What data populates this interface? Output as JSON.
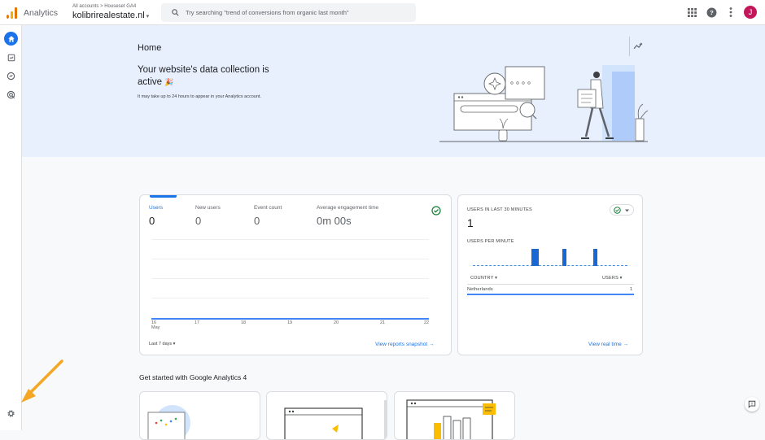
{
  "header": {
    "app_name": "Analytics",
    "breadcrumb": "All accounts > Houseset GA4",
    "property": "kolibrirealestate.nl",
    "property_caret": "▾",
    "search_placeholder": "Try searching \"trend of conversions from organic last month\"",
    "avatar_letter": "J",
    "logo_colors": [
      "#f9ab00",
      "#e37400",
      "#e37400"
    ]
  },
  "nav": {
    "items": [
      "home-icon",
      "reports-icon",
      "explore-icon",
      "advertising-icon"
    ],
    "active_color": "#1a73e8",
    "settings": "gear-icon"
  },
  "hero": {
    "title": "Home",
    "headline_line1": "Your website's data collection is",
    "headline_line2": "active",
    "headline_emoji": "🎉",
    "subtext": "It may take up to 24 hours to appear in your Analytics account."
  },
  "overview": {
    "metrics": [
      {
        "label": "Users",
        "value": "0"
      },
      {
        "label": "New users",
        "value": "0"
      },
      {
        "label": "Event count",
        "value": "0"
      },
      {
        "label": "Average engagement time",
        "value": "0m 00s"
      }
    ],
    "x_ticks": [
      "16",
      "17",
      "18",
      "19",
      "20",
      "21",
      "22"
    ],
    "x_month": "May",
    "date_range": "Last 7 days ▾",
    "link": "View reports snapshot →"
  },
  "realtime": {
    "title": "USERS IN LAST 30 MINUTES",
    "value": "1",
    "per_minute_label": "USERS PER MINUTE",
    "bars": [
      0,
      0,
      0,
      0,
      0,
      0,
      0,
      0,
      0,
      0,
      0,
      0,
      0,
      0,
      0,
      0,
      0,
      1,
      1,
      0,
      0,
      0,
      0,
      0,
      0,
      0,
      1,
      0,
      0,
      0,
      0,
      0,
      0,
      0,
      0,
      1,
      0,
      0,
      0,
      0,
      0,
      0,
      0,
      0,
      0
    ],
    "country_header": "COUNTRY ▾",
    "users_header": "USERS ▾",
    "rows": [
      {
        "country": "Netherlands",
        "users": "1"
      }
    ],
    "link": "View real time →"
  },
  "getting_started": {
    "title": "Get started with Google Analytics 4"
  }
}
